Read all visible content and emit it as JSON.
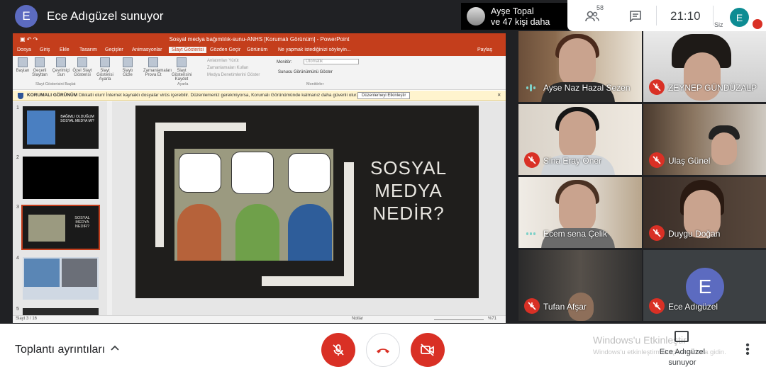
{
  "top_bar": {
    "presenter_initial": "E",
    "presenter_title": "Ece Adıgüzel sunuyor",
    "people_summary_line1": "Ayşe Topal",
    "people_summary_line2": "ve 47 kişi daha",
    "participant_count": "58",
    "clock": "21:10",
    "self_initial": "E",
    "self_label": "Siz"
  },
  "presentation": {
    "window_title": "Sosyal medya bağımlılık-sunu-ANHS [Korumalı Görünüm] - PowerPoint",
    "tabs": [
      "Dosya",
      "Giriş",
      "Ekle",
      "Tasarım",
      "Geçişler",
      "Animasyonlar",
      "Slayt Gösterisi",
      "Gözden Geçir",
      "Görünüm",
      "Ne yapmak istediğinizi söyleyin..."
    ],
    "share_label": "Paylaş",
    "ribbon_buttons": [
      "Baştan",
      "Geçerli Slayttan",
      "Çevrimiçi Sun",
      "Özel Slayt Gösterisi",
      "Slayt Gösterisi Ayarla",
      "Slaytı Gizle",
      "Zamanlamaları Prova Et",
      "Slayt Gösterisini Kaydet"
    ],
    "ribbon_groups": [
      "Slayt Gösterisini Başlat",
      "Ayarla",
      "Monitörler"
    ],
    "ribbon_checks": [
      "Anlatımları Yürüt",
      "Zamanlamaları Kullan",
      "Medya Denetimlerini Göster",
      "Sunucu Görünümünü Göster"
    ],
    "monitor_label": "Monitör:",
    "monitor_value": "Otomatik",
    "warning_title": "KORUMALI GÖRÜNÜM",
    "warning_text": "Dikkatli olun! İnternet kaynaklı dosyalar virüs içerebilir. Düzenlemeniz gerekmiyorsa, Korumalı Görünümünde kalmanız daha güvenli olur.",
    "warning_button": "Düzenlemeyi Etkinleştir",
    "thumbnail_numbers": [
      "1",
      "2",
      "3",
      "4",
      "5"
    ],
    "thumb1_text": "BAĞIMLI OLDUĞUM SOSYAL MEDYA MI?",
    "thumb3_text": "SOSYAL MEDYA NEDİR?",
    "slide_title_lines": [
      "SOSYAL",
      "MEDYA",
      "NEDİR?"
    ],
    "status_slide": "Slayt 3 / 16",
    "status_notes": "Notlar",
    "status_zoom": "%71"
  },
  "participants": [
    {
      "name": "Ayse Naz Hazal Sezen",
      "muted": false,
      "speaking": true
    },
    {
      "name": "ZEYNEP GÜNDÜZALP",
      "muted": true
    },
    {
      "name": "Sina Eray Öner",
      "muted": true
    },
    {
      "name": "Ulaş Günel",
      "muted": true
    },
    {
      "name": "Ecem sena Çelik",
      "muted": false,
      "speaking": true
    },
    {
      "name": "Duygu Doğan",
      "muted": true
    },
    {
      "name": "Tufan Afşar",
      "muted": true
    },
    {
      "name": "Ece Adıgüzel",
      "muted": true,
      "avatar_initial": "E"
    }
  ],
  "bottom_bar": {
    "meeting_details": "Toplantı ayrıntıları",
    "watermark_title": "Windows'u Etkinleştir",
    "watermark_sub": "Windows'u etkinleştirmek için Ayarlar'a gidin.",
    "presenting_label": "Ece Adıgüzel sunuyor"
  }
}
